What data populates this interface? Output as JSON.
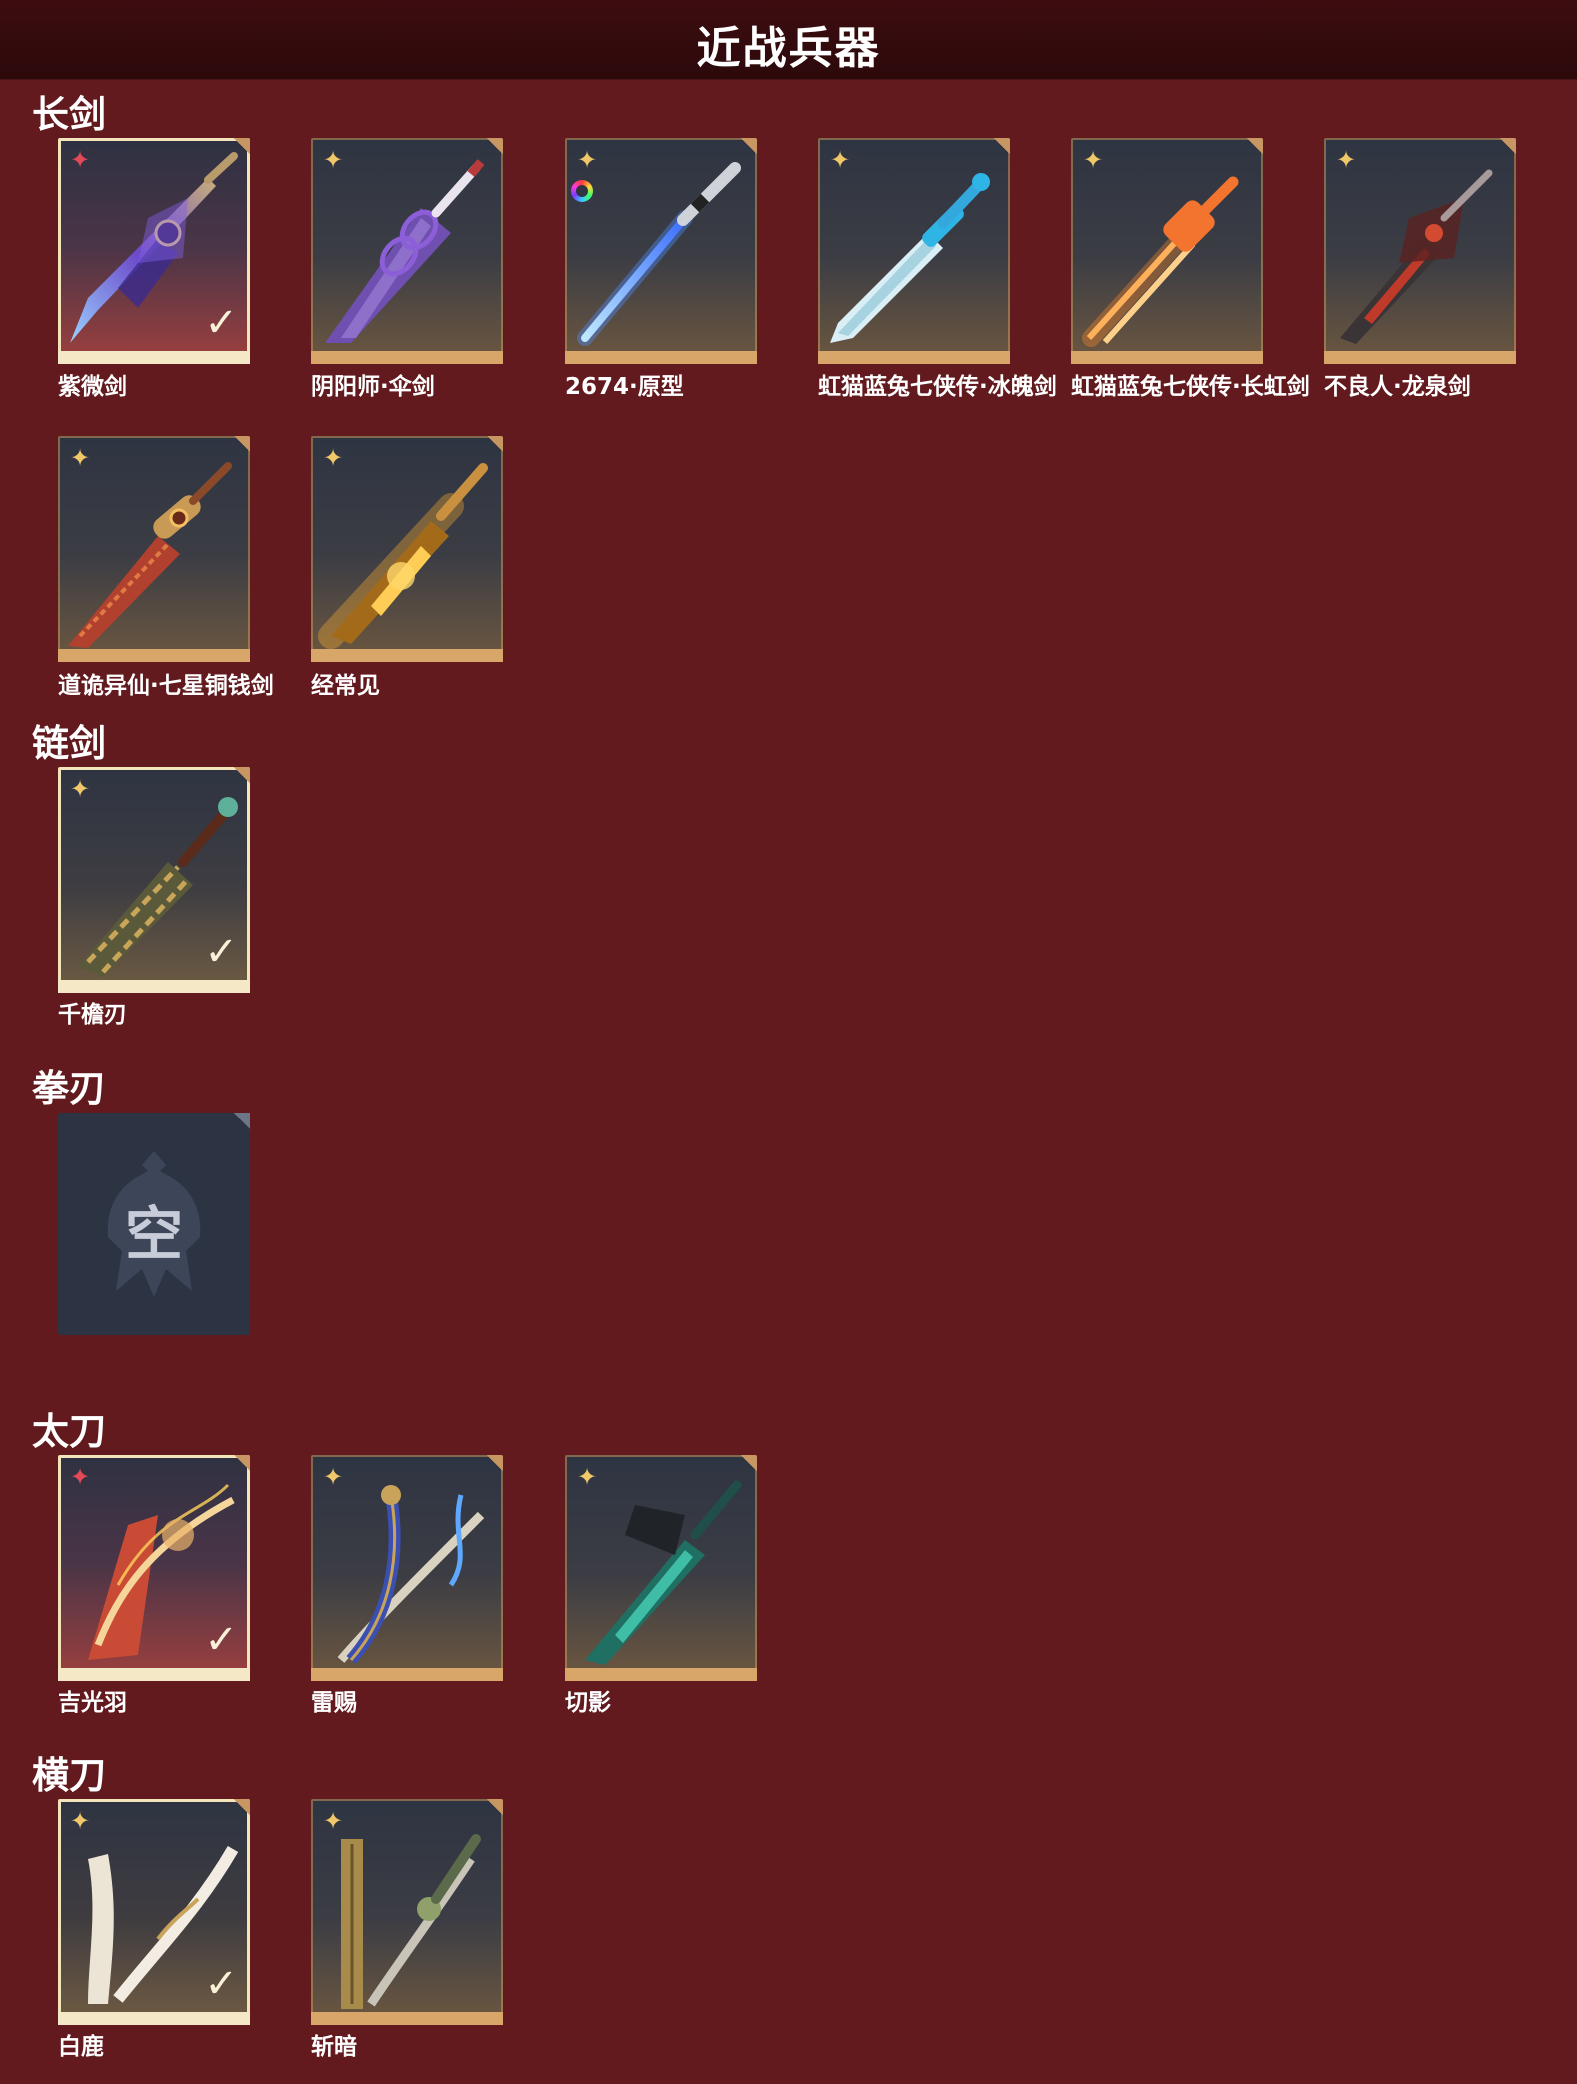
{
  "page": {
    "title": "近战兵器"
  },
  "sections": {
    "longsword": {
      "title": "长剑",
      "items": [
        {
          "name": "紫微剑",
          "rarity": "red-star-icon",
          "equipped": true
        },
        {
          "name": "阴阳师·伞剑",
          "rarity": "gold-star-icon",
          "equipped": false
        },
        {
          "name": "2674·原型",
          "rarity": "gold-star-icon",
          "equipped": false,
          "color_variant": "color-wheel-icon"
        },
        {
          "name": "虹猫蓝兔七侠传·冰魄剑",
          "rarity": "gold-star-icon",
          "equipped": false
        },
        {
          "name": "虹猫蓝兔七侠传·长虹剑",
          "rarity": "gold-star-icon",
          "equipped": false
        },
        {
          "name": "不良人·龙泉剑",
          "rarity": "gold-star-icon",
          "equipped": false
        },
        {
          "name": "道诡异仙·七星铜钱剑",
          "rarity": "gold-star-icon",
          "equipped": false
        },
        {
          "name": "经常见",
          "rarity": "gold-star-icon",
          "equipped": false
        }
      ]
    },
    "chainsword": {
      "title": "链剑",
      "items": [
        {
          "name": "千檐刃",
          "rarity": "gold-star-icon",
          "equipped": true
        }
      ]
    },
    "fistblade": {
      "title": "拳刃",
      "empty_label": "空"
    },
    "tachi": {
      "title": "太刀",
      "items": [
        {
          "name": "吉光羽",
          "rarity": "red-star-icon",
          "equipped": true
        },
        {
          "name": "雷赐",
          "rarity": "gold-star-icon",
          "equipped": false
        },
        {
          "name": "切影",
          "rarity": "gold-star-icon",
          "equipped": false
        }
      ]
    },
    "hengdao": {
      "title": "横刀",
      "items": [
        {
          "name": "白鹿",
          "rarity": "gold-star-icon",
          "equipped": true
        },
        {
          "name": "斩暗",
          "rarity": "gold-star-icon",
          "equipped": false
        }
      ]
    }
  },
  "icons": {
    "check": "✓",
    "star": "✦"
  },
  "colors": {
    "background": "#621a1f",
    "header": "#2c090b",
    "card_border_gold": "#d9a66a",
    "card_border_legend": "#f4e8c6",
    "star_gold": "#f1c869",
    "star_red": "#e34a55"
  }
}
